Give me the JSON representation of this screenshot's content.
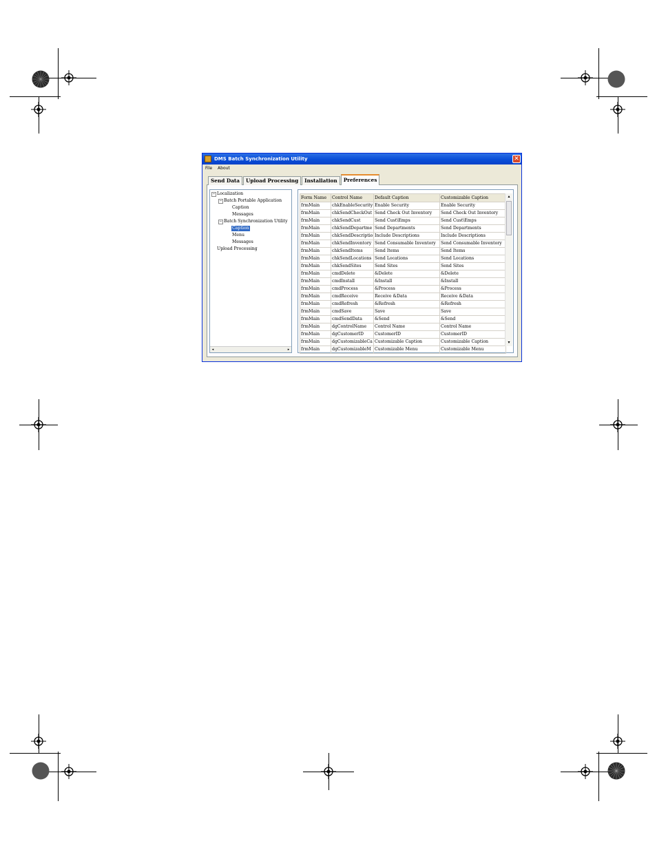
{
  "window": {
    "title": "DMS Batch Synchronization Utility",
    "close_glyph": "✕"
  },
  "menu": [
    "File",
    "About"
  ],
  "tabs": [
    {
      "label": "Send Data",
      "active": false
    },
    {
      "label": "Upload Processing",
      "active": false
    },
    {
      "label": "Installation",
      "active": false
    },
    {
      "label": "Preferences",
      "active": true
    }
  ],
  "tree": {
    "nodes": [
      {
        "label": "Localization",
        "toggle": "−"
      },
      {
        "label": "Batch Portable Application",
        "toggle": "−"
      },
      {
        "label": "Caption"
      },
      {
        "label": "Messages"
      },
      {
        "label": "Batch Synchronization Utility",
        "toggle": "−"
      },
      {
        "label": "Caption",
        "selected": true
      },
      {
        "label": "Menu"
      },
      {
        "label": "Messages"
      },
      {
        "label": "Upload Processing"
      }
    ],
    "scroll_left": "◂",
    "scroll_right": "▸"
  },
  "grid": {
    "columns": [
      "Form Name",
      "Control Name",
      "Default Caption",
      "Customizable Caption"
    ],
    "rows": [
      [
        "frmMain",
        "chkEnableSecurity",
        "Enable Security",
        "Enable Security"
      ],
      [
        "frmMain",
        "chkSendCheckOut",
        "Send Check Out Inventory",
        "Send Check Out Inventory"
      ],
      [
        "frmMain",
        "chkSendCust",
        "Send Cust\\Emps",
        "Send Cust\\Emps"
      ],
      [
        "frmMain",
        "chkSendDepartme",
        "Send Departments",
        "Send Departments"
      ],
      [
        "frmMain",
        "chkSendDescriptio",
        "Include Descriptions",
        "Include Descriptions"
      ],
      [
        "frmMain",
        "chkSendInventory",
        "Send Consumable Inventory",
        "Send Consumable Inventory"
      ],
      [
        "frmMain",
        "chkSendItems",
        "Send Items",
        "Send Items"
      ],
      [
        "frmMain",
        "chkSendLocations",
        "Send Locations",
        "Send Locations"
      ],
      [
        "frmMain",
        "chkSendSites",
        "Send Sites",
        "Send Sites"
      ],
      [
        "frmMain",
        "cmdDelete",
        "&Delete",
        "&Delete"
      ],
      [
        "frmMain",
        "cmdInstall",
        "&Install",
        "&Install"
      ],
      [
        "frmMain",
        "cmdProcess",
        "&Process",
        "&Process"
      ],
      [
        "frmMain",
        "cmdReceive",
        "Receive &Data",
        "Receive &Data"
      ],
      [
        "frmMain",
        "cmdRefresh",
        "&Refresh",
        "&Refresh"
      ],
      [
        "frmMain",
        "cmdSave",
        "Save",
        "Save"
      ],
      [
        "frmMain",
        "cmdSendData",
        "&Send",
        "&Send"
      ],
      [
        "frmMain",
        "dgControlName",
        "Control Name",
        "Control Name"
      ],
      [
        "frmMain",
        "dgCustomerID",
        "CustomerID",
        "CustomerID"
      ],
      [
        "frmMain",
        "dgCustomizableCa",
        "Customizable Caption",
        "Customizable Caption"
      ],
      [
        "frmMain",
        "dgCustomizableM",
        "Customizable Menu",
        "Customizable Menu"
      ]
    ],
    "scroll_up": "▴",
    "scroll_down": "▾"
  }
}
